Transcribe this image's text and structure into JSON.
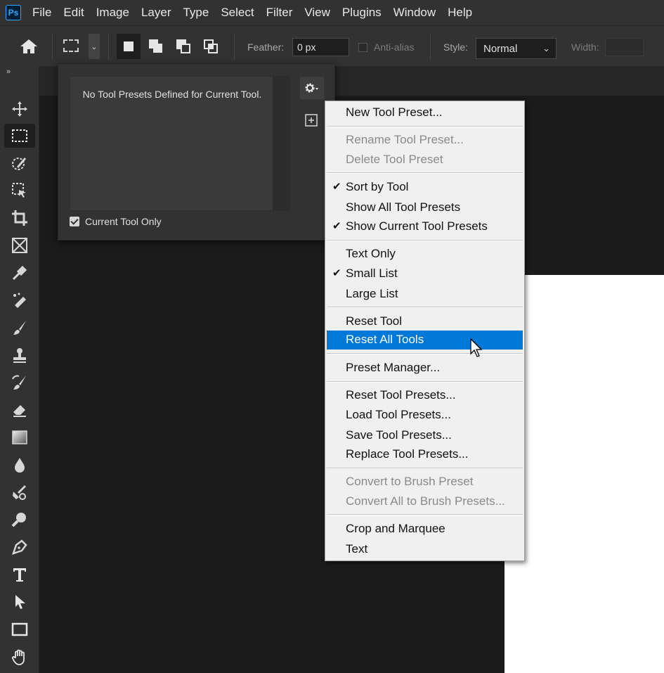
{
  "app": {
    "logo_text": "Ps"
  },
  "menu": [
    "File",
    "Edit",
    "Image",
    "Layer",
    "Type",
    "Select",
    "Filter",
    "View",
    "Plugins",
    "Window",
    "Help"
  ],
  "options_bar": {
    "feather_label": "Feather:",
    "feather_value": "0 px",
    "antialias_label": "Anti-alias",
    "style_label": "Style:",
    "style_value": "Normal",
    "width_label": "Width:",
    "width_value": ""
  },
  "toolbar": {
    "collapse_glyph": "»",
    "tools": [
      "move-tool",
      "rectangular-marquee-tool",
      "object-selection-tool",
      "crop-tool-alt",
      "crop-tool",
      "frame-tool",
      "eyedropper-tool",
      "spot-healing-brush-tool",
      "brush-tool",
      "clone-stamp-tool",
      "history-brush-tool",
      "eraser-tool",
      "gradient-tool",
      "blur-tool",
      "dodge-tool",
      "zoom-tool",
      "pen-tool",
      "type-tool",
      "path-selection-tool",
      "rectangle-tool",
      "hand-tool"
    ],
    "active_tool": "rectangular-marquee-tool"
  },
  "presets_panel": {
    "empty_message": "No Tool Presets Defined for Current Tool.",
    "current_tool_only_label": "Current Tool Only",
    "current_tool_only_checked": true
  },
  "context_menu": {
    "items": [
      {
        "label": "New Tool Preset...",
        "enabled": true,
        "checked": false
      },
      {
        "label": "Rename Tool Preset...",
        "enabled": false,
        "checked": false
      },
      {
        "label": "Delete Tool Preset",
        "enabled": false,
        "checked": false
      },
      {
        "label": "Sort by Tool",
        "enabled": true,
        "checked": true
      },
      {
        "label": "Show All Tool Presets",
        "enabled": true,
        "checked": false
      },
      {
        "label": "Show Current Tool Presets",
        "enabled": true,
        "checked": true
      },
      {
        "label": "Text Only",
        "enabled": true,
        "checked": false
      },
      {
        "label": "Small List",
        "enabled": true,
        "checked": true
      },
      {
        "label": "Large List",
        "enabled": true,
        "checked": false
      },
      {
        "label": "Reset Tool",
        "enabled": true,
        "checked": false
      },
      {
        "label": "Reset All Tools",
        "enabled": true,
        "checked": false,
        "highlighted": true
      },
      {
        "label": "Preset Manager...",
        "enabled": true,
        "checked": false
      },
      {
        "label": "Reset Tool Presets...",
        "enabled": true,
        "checked": false
      },
      {
        "label": "Load Tool Presets...",
        "enabled": true,
        "checked": false
      },
      {
        "label": "Save Tool Presets...",
        "enabled": true,
        "checked": false
      },
      {
        "label": "Replace Tool Presets...",
        "enabled": true,
        "checked": false
      },
      {
        "label": "Convert to Brush Preset",
        "enabled": false,
        "checked": false
      },
      {
        "label": "Convert All to Brush Presets...",
        "enabled": false,
        "checked": false
      },
      {
        "label": "Crop and Marquee",
        "enabled": true,
        "checked": false
      },
      {
        "label": "Text",
        "enabled": true,
        "checked": false
      }
    ],
    "check_glyph": "✔"
  },
  "colors": {
    "highlight": "#0078d7",
    "ui_dark": "#323232",
    "canvas": "#ffffff"
  }
}
